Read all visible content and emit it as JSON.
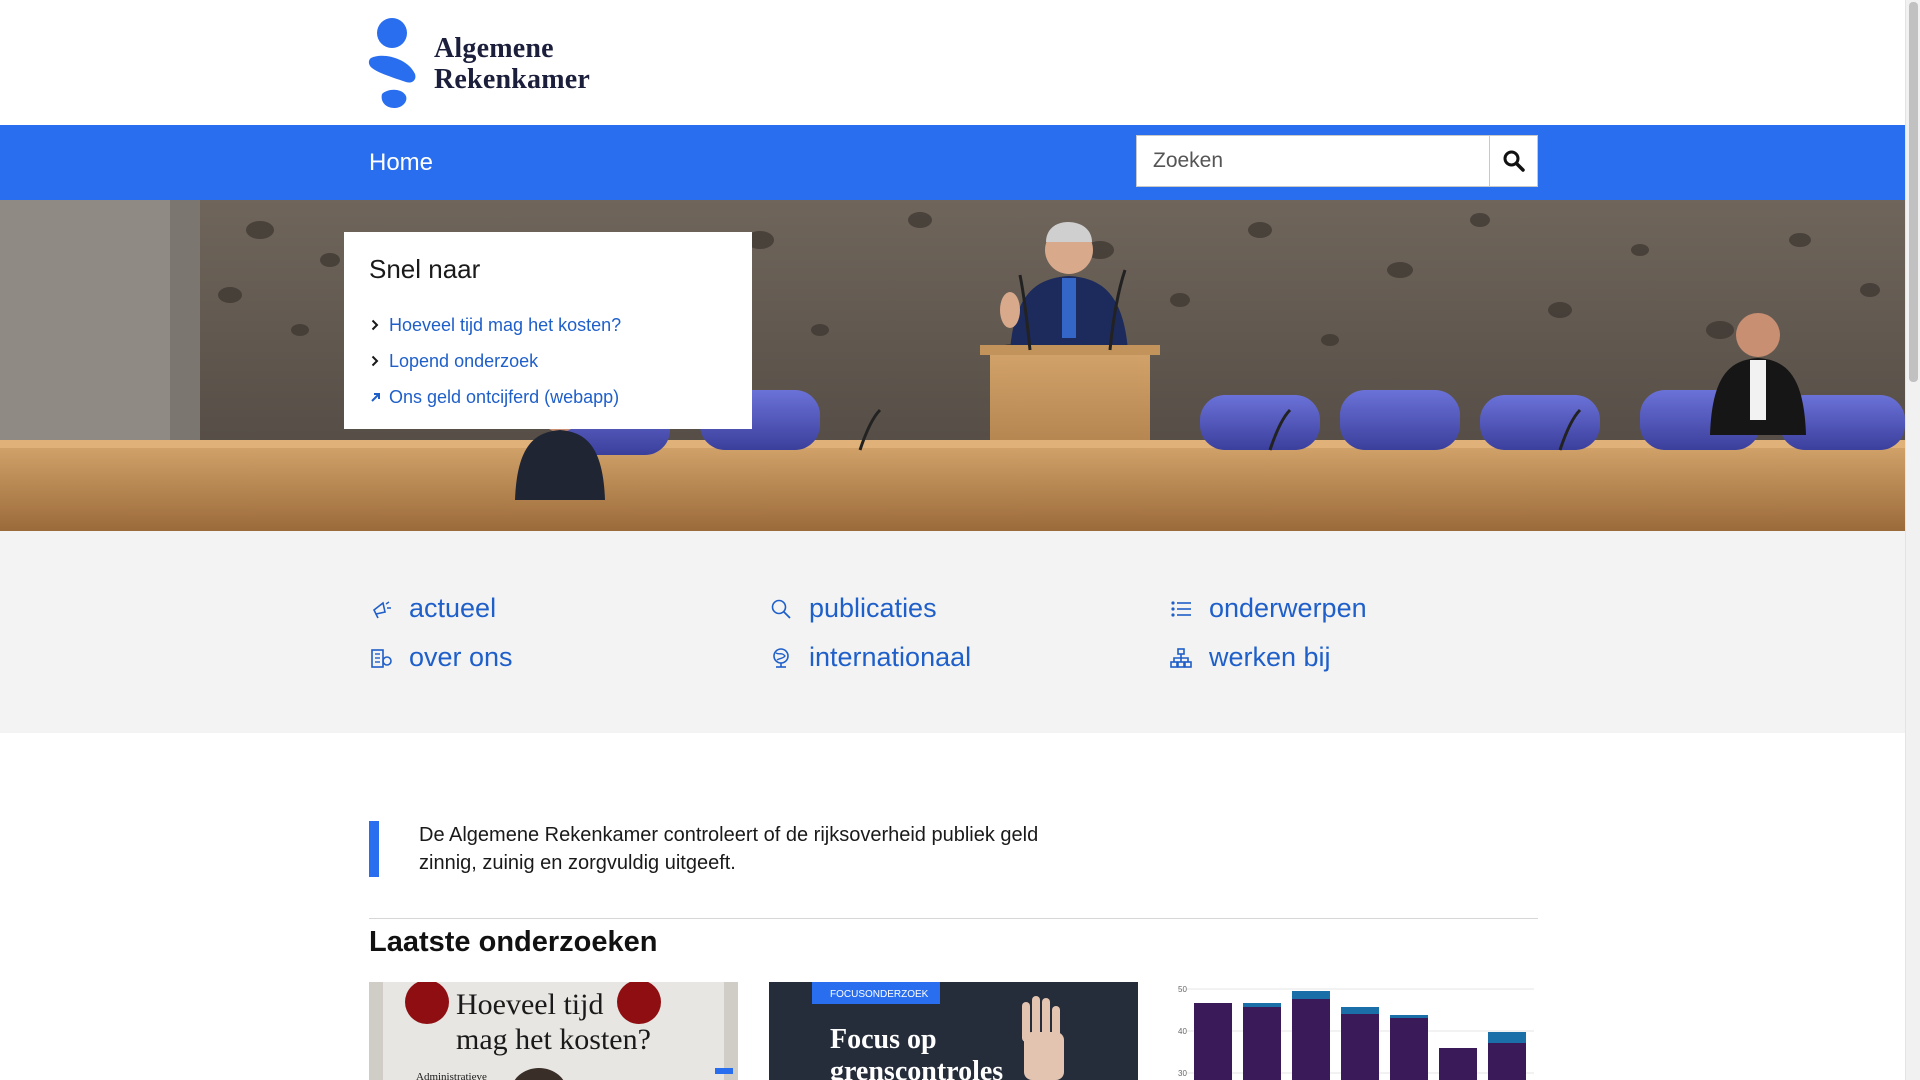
{
  "header": {
    "logo_line1": "Algemene",
    "logo_line2": "Rekenkamer",
    "brand_color": "#2a6ef0",
    "logo_navy": "#1b1f3b"
  },
  "nav": {
    "home_label": "Home",
    "search_placeholder": "Zoeken",
    "search_icon": "magnifier-icon"
  },
  "quick_links": {
    "title": "Snel naar",
    "items": [
      {
        "label": "Hoeveel tijd mag het kosten?",
        "icon": "chevron-right-icon"
      },
      {
        "label": "Lopend onderzoek",
        "icon": "chevron-right-icon"
      },
      {
        "label": "Ons geld ontcijferd (webapp)",
        "icon": "external-arrow-icon"
      }
    ]
  },
  "categories": [
    {
      "label": "actueel",
      "icon": "megaphone-icon"
    },
    {
      "label": "publicaties",
      "icon": "search-icon"
    },
    {
      "label": "onderwerpen",
      "icon": "list-icon"
    },
    {
      "label": "over ons",
      "icon": "building-icon"
    },
    {
      "label": "internationaal",
      "icon": "globe-icon"
    },
    {
      "label": "werken bij",
      "icon": "org-chart-icon"
    }
  ],
  "intro_text": "De Algemene Rekenkamer controleert of de rijksoverheid publiek geld zinnig, zuinig en zorgvuldig uitgeeft.",
  "latest": {
    "title": "Laatste onderzoeken",
    "cards": [
      {
        "headline_line1": "Hoeveel tijd",
        "headline_line2": "mag het kosten?",
        "sub": "Administratieve"
      },
      {
        "tag": "FOCUSONDERZOEK",
        "headline_line1": "Focus op",
        "headline_line2": "grenscontroles"
      },
      {
        "axis_labels": [
          "50",
          "40",
          "30"
        ]
      }
    ]
  }
}
